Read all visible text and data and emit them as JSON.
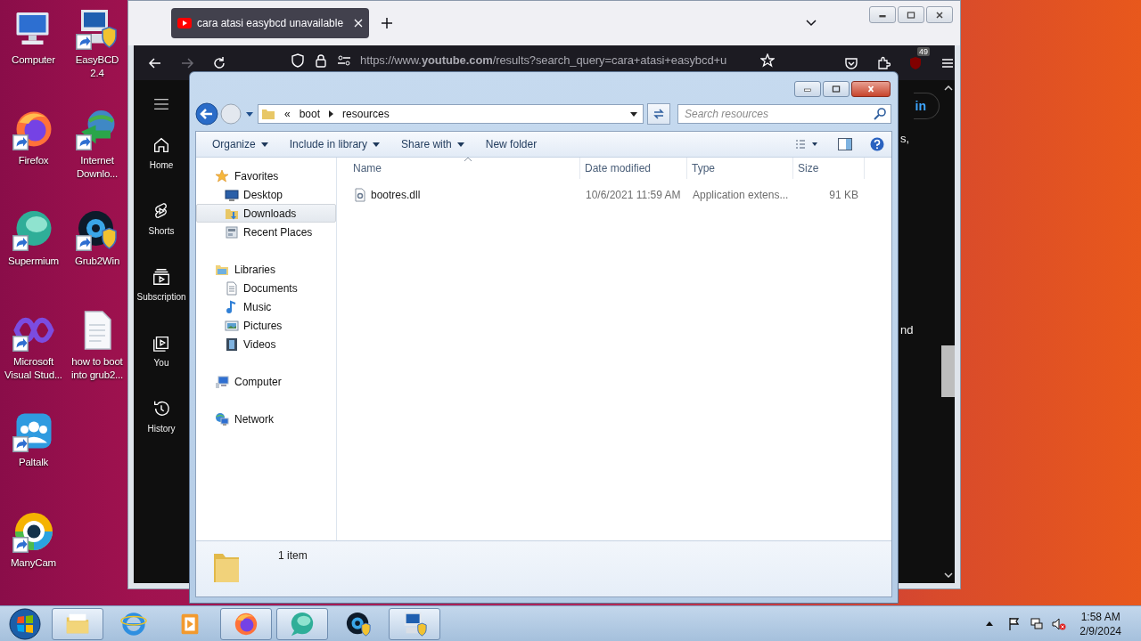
{
  "desktop": {
    "icon_columns": [
      [
        {
          "label": "Computer",
          "kind": "computer",
          "shortcut": false
        },
        {
          "label": "Firefox",
          "kind": "firefox",
          "shortcut": true
        },
        {
          "label": "Supermium",
          "kind": "supermium",
          "shortcut": true
        },
        {
          "label": "Microsoft Visual Stud...",
          "kind": "vs",
          "shortcut": true
        },
        {
          "label": "Paltalk",
          "kind": "paltalk",
          "shortcut": true
        },
        {
          "label": "ManyCam",
          "kind": "manycam",
          "shortcut": true
        }
      ],
      [
        {
          "label": "EasyBCD 2.4",
          "kind": "easybcd",
          "shortcut": true
        },
        {
          "label": "Internet Downlo...",
          "kind": "idm",
          "shortcut": true
        },
        {
          "label": "Grub2Win",
          "kind": "grub",
          "shortcut": true
        },
        {
          "label": "how to boot into grub2...",
          "kind": "document",
          "shortcut": false
        }
      ]
    ]
  },
  "browser": {
    "tabs": [
      {
        "title": "cara atasi easybcd unavailable",
        "selected": true
      }
    ],
    "url": "https://www.**youtube.com**/results?search_query=cara+atasi+easybcd+u",
    "extension_badge": "49",
    "sidebar": [
      {
        "label": "Home",
        "kind": "home"
      },
      {
        "label": "Shorts",
        "kind": "shorts"
      },
      {
        "label": "Subscription",
        "kind": "subs"
      },
      {
        "label": "You",
        "kind": "you"
      },
      {
        "label": "History",
        "kind": "history"
      }
    ],
    "sign_in_fragment": "in",
    "text_fragments": [
      "s,",
      "nd"
    ]
  },
  "explorer": {
    "breadcrumb_overflow": "«",
    "breadcrumb": [
      "boot",
      "resources"
    ],
    "search_placeholder": "Search resources",
    "toolbar": [
      {
        "label": "Organize",
        "menu": true
      },
      {
        "label": "Include in library",
        "menu": true
      },
      {
        "label": "Share with",
        "menu": true
      },
      {
        "label": "New folder",
        "menu": false
      }
    ],
    "nav": [
      {
        "label": "Favorites",
        "kind": "favorites",
        "selected": false,
        "children": [
          {
            "label": "Desktop",
            "kind": "desktop",
            "selected": false
          },
          {
            "label": "Downloads",
            "kind": "downloads",
            "selected": true
          },
          {
            "label": "Recent Places",
            "kind": "recent",
            "selected": false
          }
        ]
      },
      {
        "label": "Libraries",
        "kind": "libraries",
        "selected": false,
        "children": [
          {
            "label": "Documents",
            "kind": "documents",
            "selected": false
          },
          {
            "label": "Music",
            "kind": "music",
            "selected": false
          },
          {
            "label": "Pictures",
            "kind": "pictures",
            "selected": false
          },
          {
            "label": "Videos",
            "kind": "videos",
            "selected": false
          }
        ]
      },
      {
        "label": "Computer",
        "kind": "computer",
        "selected": false
      },
      {
        "label": "Network",
        "kind": "network",
        "selected": false
      }
    ],
    "columns": [
      {
        "label": "Name",
        "sorted": true
      },
      {
        "label": "Date modified",
        "sorted": false
      },
      {
        "label": "Type",
        "sorted": false
      },
      {
        "label": "Size",
        "sorted": false
      }
    ],
    "files": [
      {
        "name": "bootres.dll",
        "date": "10/6/2021 11:59 AM",
        "type": "Application extens...",
        "size": "91 KB"
      }
    ],
    "status": "1 item"
  },
  "taskbar": {
    "buttons": [
      {
        "kind": "explorer",
        "active": true
      },
      {
        "kind": "ie",
        "active": false
      },
      {
        "kind": "media",
        "active": false
      },
      {
        "kind": "firefox",
        "active": true
      },
      {
        "kind": "supermium",
        "active": true
      },
      {
        "kind": "grub",
        "active": false
      },
      {
        "kind": "easybcd",
        "active": true
      }
    ],
    "clock": {
      "time": "1:58 AM",
      "date": "2/9/2024"
    }
  }
}
